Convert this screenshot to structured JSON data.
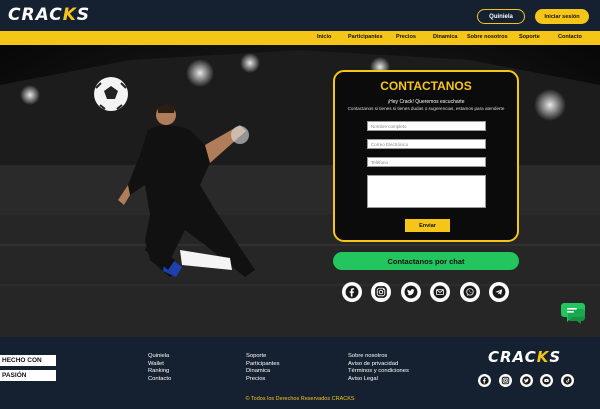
{
  "header": {
    "logo_main": "CRAC",
    "logo_k": "K",
    "logo_end": "S",
    "quiniela_label": "Quiniela",
    "login_label": "Iniciar sesión"
  },
  "nav": {
    "items": [
      "Inicio",
      "Participantes",
      "Precios",
      "Dinamica",
      "Sobre nosotros",
      "Soporte",
      "Contacto"
    ]
  },
  "contact": {
    "title": "CONTACTANOS",
    "subtitle": "¡Hey Crack! Queremos escucharte",
    "description": "Contactanos si tienes si tienes dudas o sugerencias, estamos para atenderte",
    "name_placeholder": "Nombre completo",
    "email_placeholder": "Correo Electrónico",
    "phone_placeholder": "Teléfono",
    "send_label": "Enviar",
    "chat_label": "Contactanos por chat"
  },
  "social_icons": [
    "facebook-icon",
    "instagram-icon",
    "twitter-icon",
    "email-icon",
    "whatsapp-icon",
    "telegram-icon"
  ],
  "footer": {
    "badge1": "HECHO CON",
    "badge2": "PASIÓN",
    "col1": [
      "Quiniela",
      "Wallet",
      "Ranking",
      "Contacto"
    ],
    "col2": [
      "Soporte",
      "Participantes",
      "Dinamica",
      "Precios"
    ],
    "col3": [
      "Sobre nosotros",
      "Aviso de privacidad",
      "Términos y condiciones",
      "Aviso Legal"
    ],
    "social_icons": [
      "facebook-icon",
      "instagram-icon",
      "twitter-icon",
      "youtube-icon",
      "tiktok-icon"
    ],
    "copyright": "© Todos los Derechos Reservados CRACKS"
  },
  "colors": {
    "accent": "#f5c518",
    "header_bg": "#152031",
    "chat_green": "#22c55e"
  }
}
